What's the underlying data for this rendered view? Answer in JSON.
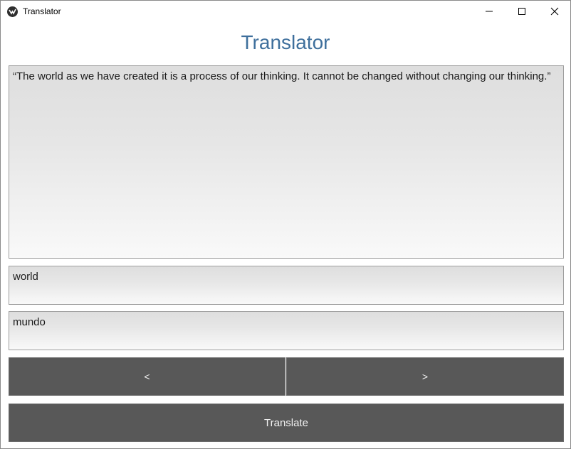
{
  "window": {
    "title": "Translator",
    "controls": [
      "minimize-icon",
      "maximize-icon",
      "close-icon"
    ]
  },
  "app": {
    "heading": "Translator",
    "main_text": "“The world as we have created it is a process of our thinking. It cannot be changed without changing our thinking.”",
    "source_word": "world",
    "target_word": "mundo",
    "prev_label": "<",
    "next_label": ">",
    "translate_label": "Translate"
  },
  "colors": {
    "heading": "#3e6f9c",
    "button_bg": "#585858",
    "button_text": "#f2f2f2"
  }
}
